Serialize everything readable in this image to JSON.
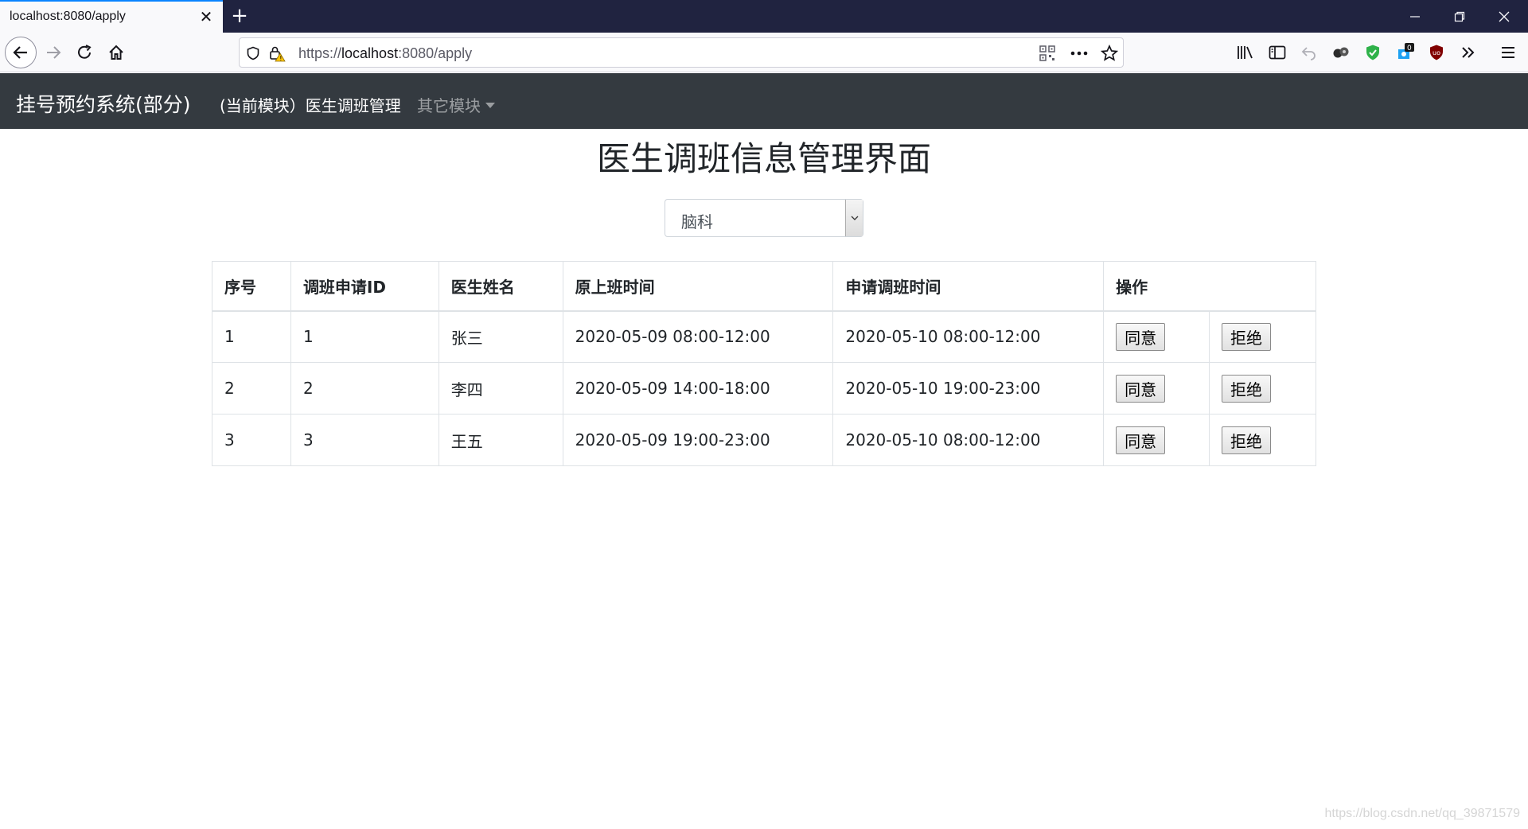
{
  "browser": {
    "tab_title": "localhost:8080/apply",
    "url_scheme": "https://",
    "url_host": "localhost",
    "url_rest": ":8080/apply",
    "addon_badge": "0"
  },
  "navbar": {
    "brand": "挂号预约系统(部分)",
    "current_module": "(当前模块）医生调班管理",
    "other_modules": "其它模块"
  },
  "page": {
    "title": "医生调班信息管理界面",
    "department_select": "脑科"
  },
  "table": {
    "headers": [
      "序号",
      "调班申请ID",
      "医生姓名",
      "原上班时间",
      "申请调班时间",
      "操作"
    ],
    "rows": [
      {
        "no": "1",
        "apply_id": "1",
        "doctor": "张三",
        "original_time": "2020-05-09 08:00-12:00",
        "requested_time": "2020-05-10 08:00-12:00",
        "agree": "同意",
        "reject": "拒绝"
      },
      {
        "no": "2",
        "apply_id": "2",
        "doctor": "李四",
        "original_time": "2020-05-09 14:00-18:00",
        "requested_time": "2020-05-10 19:00-23:00",
        "agree": "同意",
        "reject": "拒绝"
      },
      {
        "no": "3",
        "apply_id": "3",
        "doctor": "王五",
        "original_time": "2020-05-09 19:00-23:00",
        "requested_time": "2020-05-10 08:00-12:00",
        "agree": "同意",
        "reject": "拒绝"
      }
    ]
  },
  "watermark": "https://blog.csdn.net/qq_39871579"
}
